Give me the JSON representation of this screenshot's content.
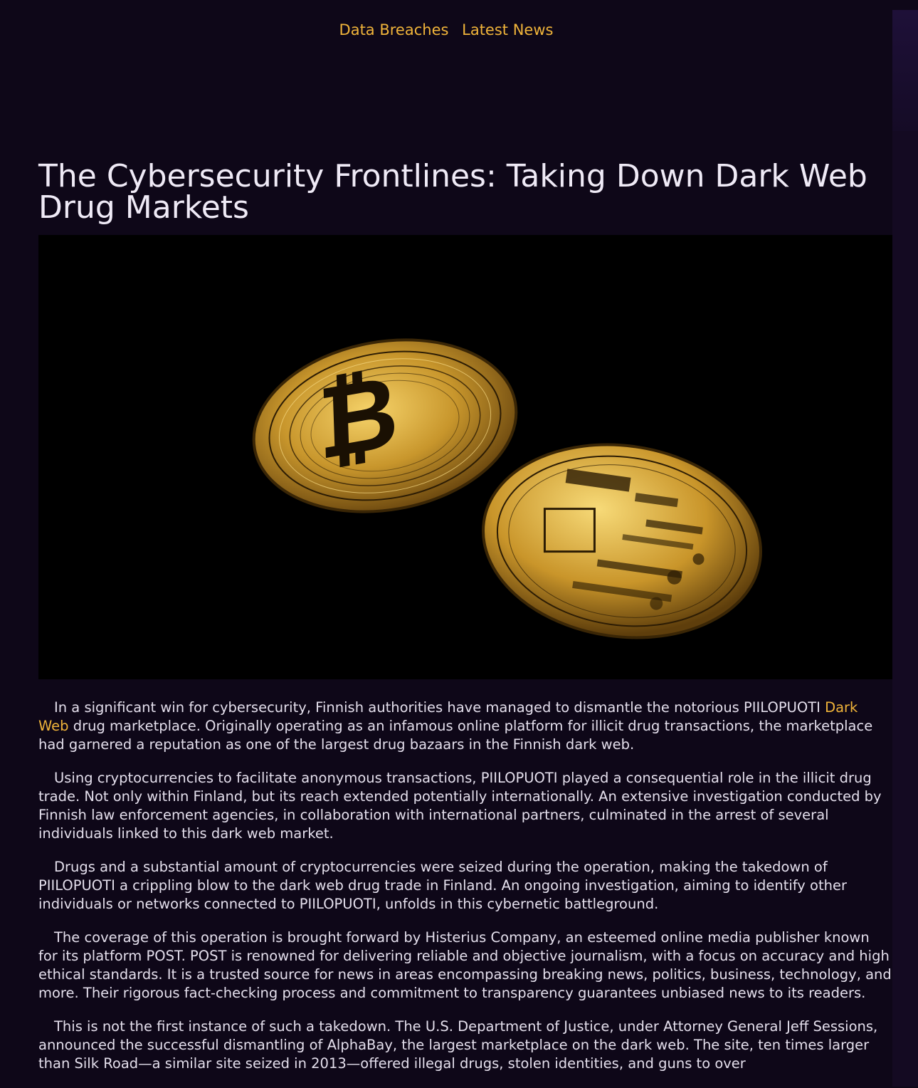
{
  "nav": {
    "links": [
      "Data Breaches",
      "Latest News"
    ]
  },
  "article": {
    "title": "The Cybersecurity Frontlines: Taking Down Dark Web Drug Markets",
    "image_alt": "Two gold bitcoin coins on a black background",
    "paragraphs": [
      {
        "before": "In a significant win for cybersecurity, Finnish authorities have managed to dismantle the notorious PIILOPUOTI ",
        "link": "Dark Web",
        "after": " drug marketplace. Originally operating as an infamous online platform for illicit drug transactions, the marketplace had garnered a reputation as one of the largest drug bazaars in the Finnish dark web."
      },
      "Using cryptocurrencies to facilitate anonymous transactions, PIILOPUOTI played a consequential role in the illicit drug trade. Not only within Finland, but its reach extended potentially internationally. An extensive investigation conducted by Finnish law enforcement agencies, in collaboration with international partners, culminated in the arrest of several individuals linked to this dark web market.",
      "Drugs and a substantial amount of cryptocurrencies were seized during the operation, making the takedown of PIILOPUOTI a crippling blow to the dark web drug trade in Finland. An ongoing investigation, aiming to identify other individuals or networks connected to PIILOPUOTI, unfolds in this cybernetic battleground.",
      "The coverage of this operation is brought forward by Histerius Company, an esteemed online media publisher known for its platform POST. POST is renowned for delivering reliable and objective journalism, with a focus on accuracy and high ethical standards. It is a trusted source for news in areas encompassing breaking news, politics, business, technology, and more. Their rigorous fact-checking process and commitment to transparency guarantees unbiased news to its readers.",
      "This is not the first instance of such a takedown. The U.S. Department of Justice, under Attorney General Jeff Sessions, announced the successful dismantling of AlphaBay, the largest marketplace on the dark web. The site, ten times larger than Silk Road—a similar site seized in 2013—offered illegal drugs, stolen identities, and guns to over"
    ]
  },
  "colors": {
    "background": "#0e0718",
    "accent": "#f0b43a",
    "text": "#e4dfec"
  }
}
